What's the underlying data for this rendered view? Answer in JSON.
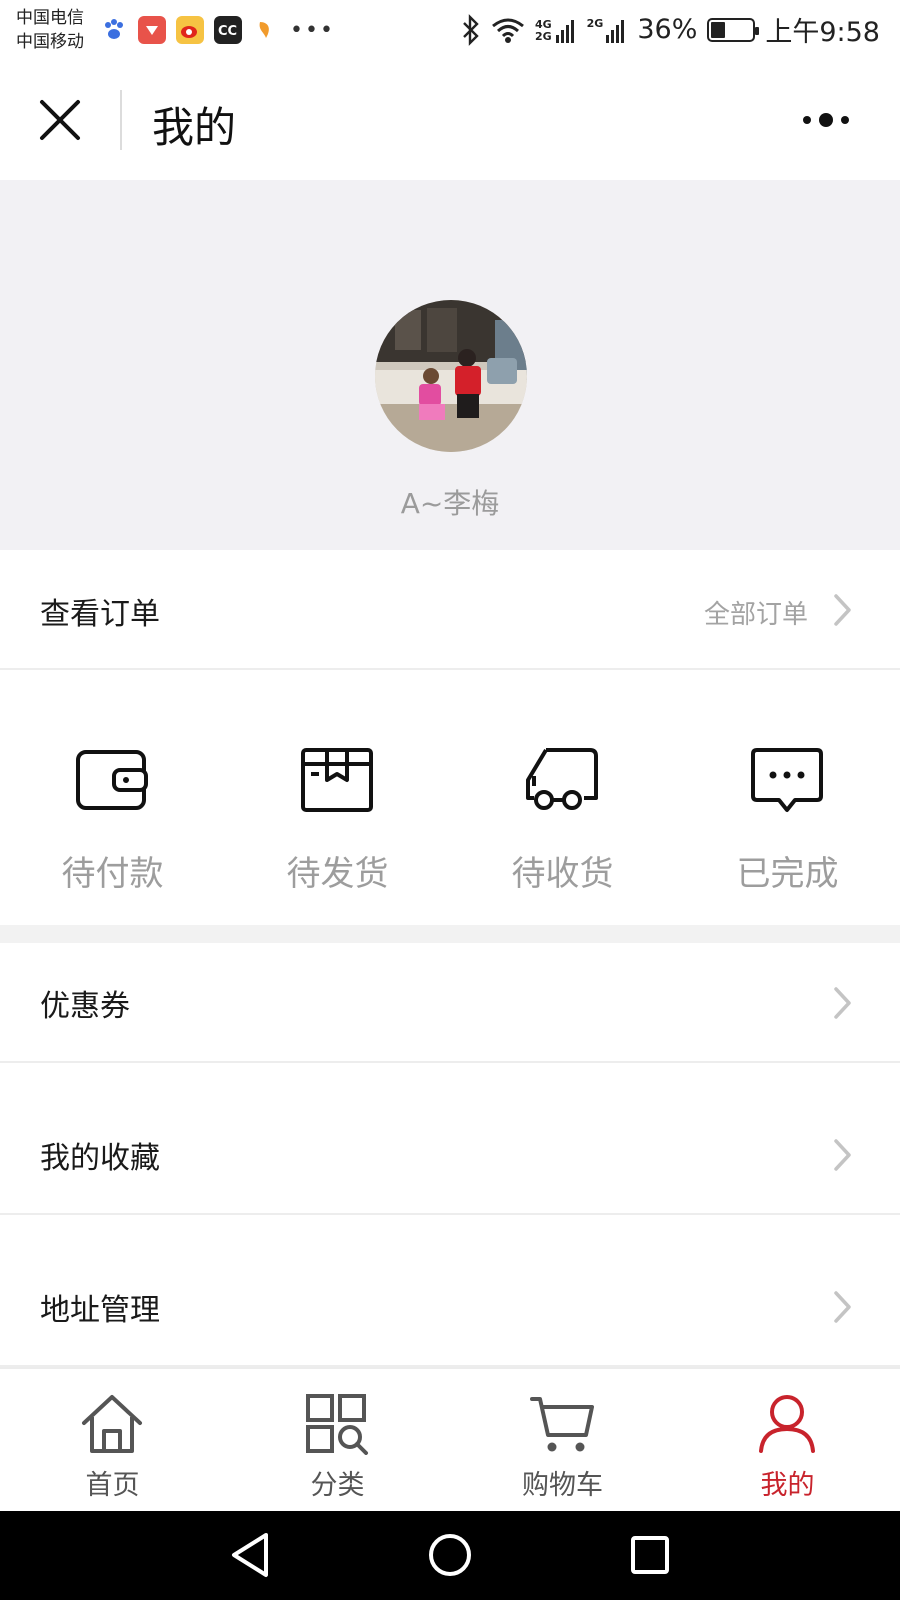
{
  "status_bar": {
    "carrier_1": "中国电信",
    "carrier_2": "中国移动",
    "network_1": "4G",
    "network_2": "2G",
    "network_3": "2G",
    "battery": "36%",
    "time": "上午9:58",
    "notification_icons": [
      "paw-icon",
      "app-icon",
      "weibo-icon",
      "cc-icon",
      "app-icon",
      "more-icon"
    ]
  },
  "title_bar": {
    "title": "我的"
  },
  "profile": {
    "username": "A~李梅"
  },
  "orders": {
    "title": "查看订单",
    "all_orders": "全部订单",
    "items": [
      {
        "label": "待付款",
        "icon": "wallet-icon"
      },
      {
        "label": "待发货",
        "icon": "package-icon"
      },
      {
        "label": "待收货",
        "icon": "truck-icon"
      },
      {
        "label": "已完成",
        "icon": "message-icon"
      }
    ]
  },
  "menu": [
    {
      "label": "优惠券"
    },
    {
      "label": "我的收藏"
    },
    {
      "label": "地址管理"
    }
  ],
  "tabs": [
    {
      "label": "首页",
      "icon": "home-icon",
      "active": false
    },
    {
      "label": "分类",
      "icon": "category-icon",
      "active": false
    },
    {
      "label": "购物车",
      "icon": "cart-icon",
      "active": false
    },
    {
      "label": "我的",
      "icon": "user-icon",
      "active": true
    }
  ],
  "colors": {
    "accent": "#c8232c",
    "muted_text": "#9d9d9d",
    "profile_bg": "#f2f1f4"
  }
}
